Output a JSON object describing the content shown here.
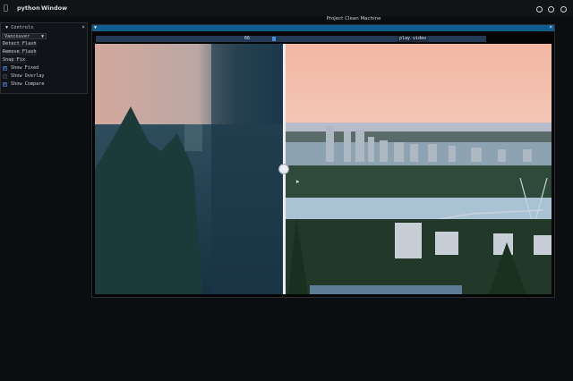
{
  "menubar": {
    "app_name": "python",
    "window_menu": "Window"
  },
  "window": {
    "title": "Project Clean Machine"
  },
  "controls": {
    "title": "Controls",
    "combo_value": "Vancouver",
    "buttons": [
      "Detect Flash",
      "Remove Flash",
      "Snap Fix"
    ],
    "checkboxes": [
      {
        "label": "Show Fixed",
        "checked": true
      },
      {
        "label": "Show Overlay",
        "checked": false
      },
      {
        "label": "Show Compare",
        "checked": true
      }
    ]
  },
  "viewer": {
    "frame_value": "66",
    "play_label": "play video"
  },
  "colors": {
    "accent": "#0f5c8e",
    "slider_bg": "#233a57",
    "slider_grab": "#4b8ad8"
  },
  "icons": {
    "apple": "apple-logo-icon",
    "close": "close-icon",
    "dropdown": "chevron-down-icon",
    "checkmark": "checkmark-icon",
    "tray": "tray-status-icon"
  }
}
